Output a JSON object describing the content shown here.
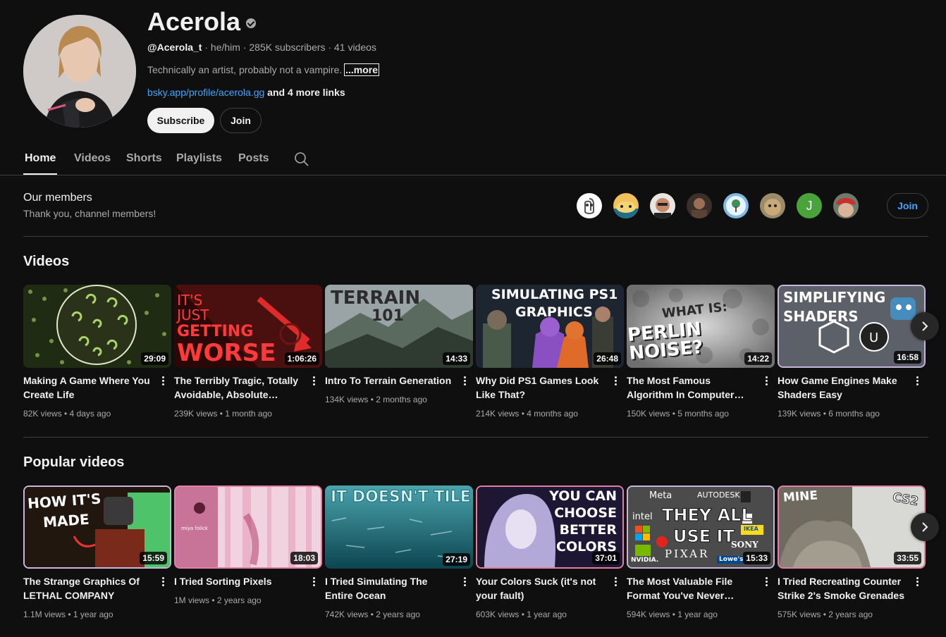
{
  "channel": {
    "name": "Acerola",
    "handle": "@Acerola_t",
    "meta_rest": " · he/him · 285K subscribers · 41 videos",
    "description": "Technically an artist, probably not a vampire.",
    "more_label": "...more",
    "link": "bsky.app/profile/acerola.gg",
    "more_links": " and 4 more links",
    "subscribe_label": "Subscribe",
    "join_label": "Join",
    "avatar_icon": "channel-avatar"
  },
  "tabs": [
    {
      "label": "Home"
    },
    {
      "label": "Videos"
    },
    {
      "label": "Shorts"
    },
    {
      "label": "Playlists"
    },
    {
      "label": "Posts"
    }
  ],
  "members": {
    "title": "Our members",
    "subtitle": "Thank you, channel members!",
    "join_label": "Join",
    "letter_avatar": "J",
    "accent_color": "#3ea6ff"
  },
  "videos_section": {
    "title": "Videos",
    "items": [
      {
        "thumb_text": "",
        "duration": "29:09",
        "title": "Making A Game Where You Create Life",
        "meta": "82K views • 4 days ago"
      },
      {
        "thumb_text1": "IT'S",
        "thumb_text2": "JUST",
        "thumb_text3": "GETTING",
        "thumb_text4": "WORSE",
        "duration": "1:06:26",
        "title": "The Terribly Tragic, Totally Avoidable, Absolute Collaps...",
        "meta": "239K views • 1 month ago"
      },
      {
        "thumb_text1": "TERRAIN",
        "thumb_text2": "101",
        "duration": "14:33",
        "title": "Intro To Terrain Generation",
        "meta": "134K views • 2 months ago"
      },
      {
        "thumb_text1": "SIMULATING PS1",
        "thumb_text2": "GRAPHICS",
        "duration": "26:48",
        "title": "Why Did PS1 Games Look Like That?",
        "meta": "214K views • 4 months ago"
      },
      {
        "thumb_text1": "WHAT IS:",
        "thumb_text2": "PERLIN NOISE?",
        "duration": "14:22",
        "title": "The Most Famous Algorithm In Computer Graphics",
        "meta": "150K views • 5 months ago"
      },
      {
        "thumb_text1": "SIMPLIFYING",
        "thumb_text2": "SHADERS",
        "duration": "16:58",
        "title": "How Game Engines Make Shaders Easy",
        "meta": "139K views • 6 months ago"
      }
    ]
  },
  "popular_section": {
    "title": "Popular videos",
    "items": [
      {
        "thumb_text1": "HOW IT'S",
        "thumb_text2": "MADE",
        "duration": "15:59",
        "title": "The Strange Graphics Of LETHAL COMPANY",
        "meta": "1.1M views • 1 year ago"
      },
      {
        "thumb_text1": "miya folick",
        "duration": "18:03",
        "title": "I Tried Sorting Pixels",
        "meta": "1M views • 2 years ago"
      },
      {
        "thumb_text1": "IT DOESN'T TILE",
        "duration": "27:19",
        "title": "I Tried Simulating The Entire Ocean",
        "meta": "742K views • 2 years ago"
      },
      {
        "thumb_text1": "YOU CAN",
        "thumb_text2": "CHOOSE",
        "thumb_text3": "BETTER",
        "thumb_text4": "COLORS",
        "duration": "37:01",
        "title": "Your Colors Suck (it's not your fault)",
        "meta": "603K views • 1 year ago"
      },
      {
        "thumb_text1": "THEY ALL",
        "thumb_text2": "USE IT",
        "logo1": "Meta",
        "logo2": "AUTODESK",
        "logo3": "intel",
        "logo4": "SONY",
        "logo5": "PIXAR",
        "logo6": "NVIDIA.",
        "logo7": "Lowe's",
        "logo8": "IKEA",
        "duration": "15:33",
        "title": "The Most Valuable File Format You've Never Heard...",
        "meta": "594K views • 1 year ago"
      },
      {
        "thumb_text1": "MINE",
        "thumb_text2": "CS2",
        "duration": "33:55",
        "title": "I Tried Recreating Counter Strike 2's Smoke Grenades",
        "meta": "575K views • 2 years ago"
      }
    ]
  }
}
